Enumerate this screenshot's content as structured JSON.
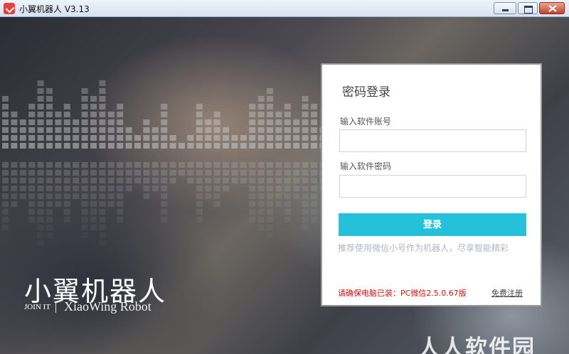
{
  "window": {
    "title": "小翼机器人 V3.13",
    "icon": "app-logo-icon",
    "controls": [
      "minimize-icon",
      "maximize-icon",
      "close-icon"
    ]
  },
  "brand": {
    "name": "小翼机器人",
    "tag": "JOIN IT",
    "english": "XiaoWing Robot"
  },
  "login": {
    "title": "密码登录",
    "account_label": "输入软件账号",
    "account_value": "",
    "password_label": "输入软件密码",
    "password_value": "",
    "submit_label": "登录",
    "submit_color": "#25c0da",
    "hint": "推荐使用微信小号作为机器人，尽享智能精彩",
    "notice": "请确保电脑已装：PC微信2.5.0.67版",
    "notice_color": "#cc1010",
    "register_label": "免费注册"
  },
  "watermark": "人人软件园"
}
